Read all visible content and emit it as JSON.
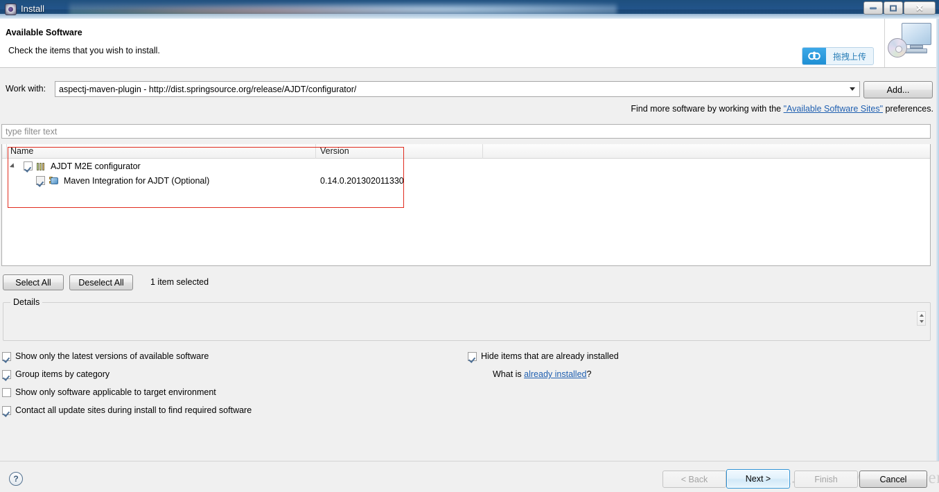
{
  "window": {
    "title": "Install",
    "app_icon": "install-gear-icon",
    "controls": {
      "minimize": "minimize-icon",
      "maximize": "maximize-icon",
      "close": "✕"
    }
  },
  "banner": {
    "title": "Available Software",
    "subtitle": "Check the items that you wish to install.",
    "image": "computer-cd-install-icon"
  },
  "upload_widget": {
    "icon": "cloud-upload-icon",
    "label": "拖拽上传"
  },
  "work_with": {
    "label": "Work with:",
    "value": "aspectj-maven-plugin - http://dist.springsource.org/release/AJDT/configurator/",
    "dropdown_icon": "chevron-down-icon",
    "add_button": "Add..."
  },
  "find_more": {
    "prefix": "Find more software by working with the ",
    "link": "\"Available Software Sites\"",
    "suffix": " preferences."
  },
  "filter": {
    "placeholder": "type filter text",
    "value": ""
  },
  "table": {
    "columns": [
      "Name",
      "Version"
    ],
    "rows": [
      {
        "indent": 0,
        "expanded": true,
        "twisty": "expand-triangle-icon",
        "checked": true,
        "check_state": "checked",
        "icon": "feature-group-icon",
        "name": "AJDT M2E configurator",
        "version": ""
      },
      {
        "indent": 1,
        "expanded": false,
        "twisty": "",
        "checked": true,
        "check_state": "checked",
        "icon": "plugin-icon",
        "name": "Maven Integration for AJDT (Optional)",
        "version": "0.14.0.201302011330"
      }
    ]
  },
  "annotation": {
    "type": "red-rectangle-highlight",
    "color": "#e02b1e"
  },
  "selection_bar": {
    "select_all": "Select All",
    "deselect_all": "Deselect All",
    "status": "1 item selected"
  },
  "details": {
    "label": "Details",
    "content": "",
    "spinner_icon": "spinner-up-down-icon"
  },
  "options_left": [
    {
      "label": "Show only the latest versions of available software",
      "checked": true
    },
    {
      "label": "Group items by category",
      "checked": true
    },
    {
      "label": "Show only software applicable to target environment",
      "checked": false
    },
    {
      "label": "Contact all update sites during install to find required software",
      "checked": true
    }
  ],
  "options_right": [
    {
      "label": "Hide items that are already installed",
      "checked": true
    }
  ],
  "what_is": {
    "prefix": "What is ",
    "link": "already installed",
    "suffix": "?"
  },
  "footer": {
    "help_icon": "?",
    "back": "< Back",
    "next": "Next >",
    "finish": "Finish",
    "cancel": "Cancel"
  },
  "watermark": "http://blog.csdn.net/shechaiwen",
  "colors": {
    "titlebar": "#22548a",
    "accent_link": "#1f5fb0",
    "annotation_red": "#e02b1e",
    "next_button_border": "#2f93d6",
    "upload_blue": "#1f8fd4"
  }
}
